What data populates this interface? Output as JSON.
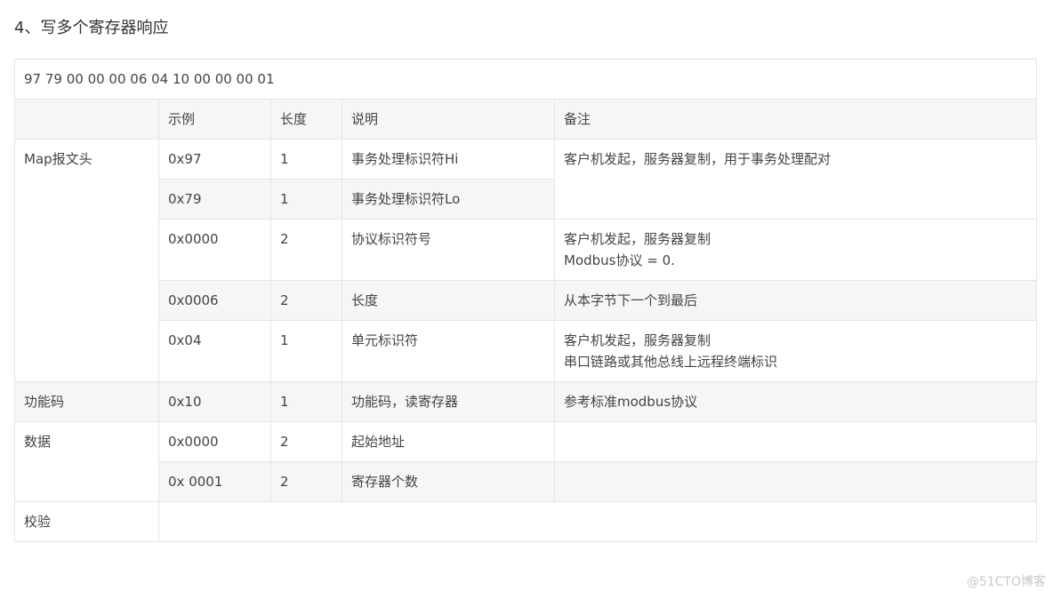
{
  "heading": "4、写多个寄存器响应",
  "frame": "97 79 00 00 00 06 04 10 00 00 00 01",
  "columns": [
    "",
    "示例",
    "长度",
    "说明",
    "备注"
  ],
  "groups": {
    "map_header": "Map报文头",
    "function_code": "功能码",
    "data": "数据",
    "checksum": "校验"
  },
  "rows": [
    {
      "example": "0x97",
      "length": "1",
      "desc": "事务处理标识符Hi",
      "note": [
        "客户机发起，服务器复制，用于事务处理配对"
      ]
    },
    {
      "example": "0x79",
      "length": "1",
      "desc": "事务处理标识符Lo"
    },
    {
      "example": "0x0000",
      "length": "2",
      "desc": "协议标识符号",
      "note": [
        "客户机发起，服务器复制",
        "Modbus协议 = 0."
      ]
    },
    {
      "example": "0x0006",
      "length": "2",
      "desc": "长度",
      "note": [
        "从本字节下一个到最后"
      ]
    },
    {
      "example": "0x04",
      "length": "1",
      "desc": "单元标识符",
      "note": [
        "客户机发起，服务器复制",
        "串口链路或其他总线上远程终端标识"
      ]
    },
    {
      "example": "0x10",
      "length": "1",
      "desc": "功能码，读寄存器",
      "note": [
        "参考标准modbus协议"
      ]
    },
    {
      "example": "0x0000",
      "length": "2",
      "desc": "起始地址",
      "note": [
        ""
      ]
    },
    {
      "example": "0x 0001",
      "length": "2",
      "desc": "寄存器个数",
      "note": [
        ""
      ]
    }
  ],
  "watermark": "@51CTO博客"
}
